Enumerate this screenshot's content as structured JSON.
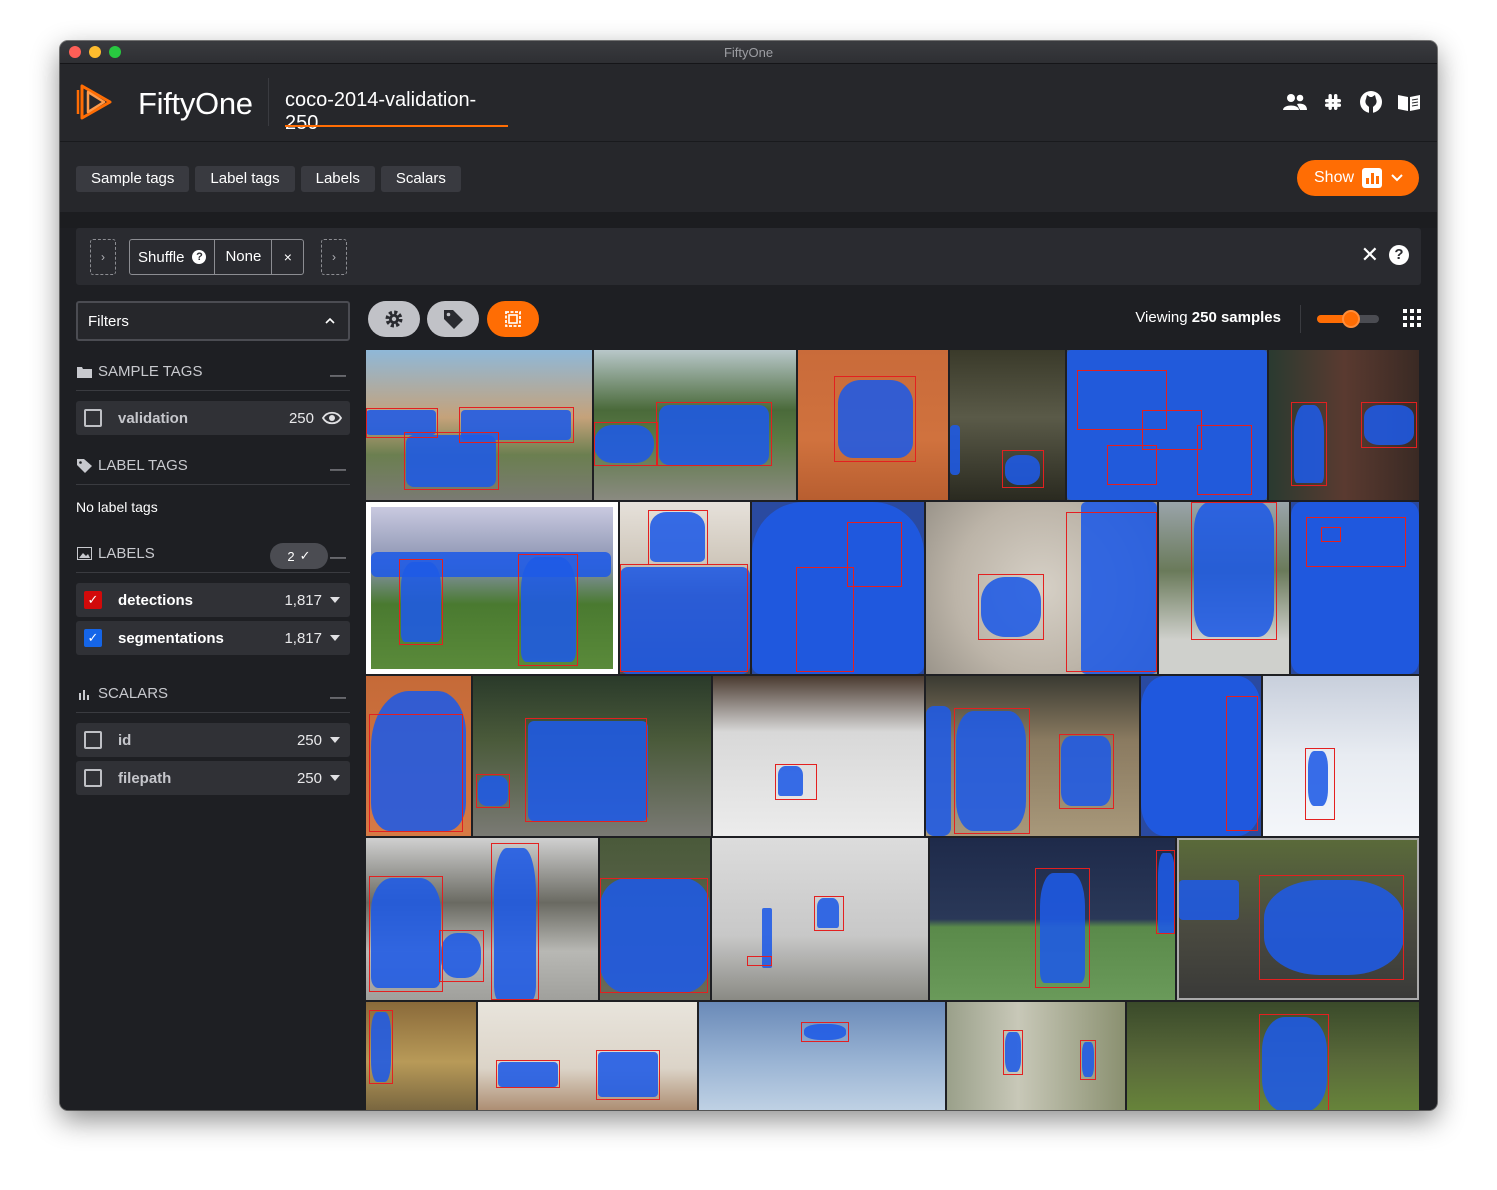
{
  "window": {
    "title": "FiftyOne"
  },
  "header": {
    "app_name": "FiftyOne",
    "dataset_name": "coco-2014-validation-250",
    "icons": [
      "people-icon",
      "slack-icon",
      "github-icon",
      "docs-book-icon"
    ]
  },
  "tabbar": {
    "tabs": [
      {
        "label": "Sample tags"
      },
      {
        "label": "Label tags"
      },
      {
        "label": "Labels"
      },
      {
        "label": "Scalars"
      }
    ],
    "show_button": {
      "label": "Show",
      "icon": "bar-chart-icon"
    }
  },
  "view_bar": {
    "stage_name": "Shuffle",
    "stage_param": "None",
    "stage_close": "×",
    "clear_label": "✕",
    "help_label": "?"
  },
  "sidebar": {
    "filters_label": "Filters",
    "sample_tags": {
      "title": "SAMPLE TAGS",
      "items": [
        {
          "label": "validation",
          "count": "250"
        }
      ]
    },
    "label_tags": {
      "title": "LABEL TAGS",
      "empty": "No label tags"
    },
    "labels": {
      "title": "LABELS",
      "badge": "2",
      "items": [
        {
          "label": "detections",
          "count": "1,817",
          "color": "#d20a0a",
          "checked": true
        },
        {
          "label": "segmentations",
          "count": "1,817",
          "color": "#1565e8",
          "checked": true
        }
      ]
    },
    "scalars": {
      "title": "SCALARS",
      "items": [
        {
          "label": "id",
          "count": "250"
        },
        {
          "label": "filepath",
          "count": "250"
        }
      ]
    }
  },
  "grid": {
    "viewing_prefix": "Viewing",
    "viewing_count": "250 samples",
    "zoom_level": 0.55,
    "toolbar_icons": [
      "gear-icon",
      "tag-icon",
      "patches-icon"
    ]
  },
  "colors": {
    "accent": "#ff6d04",
    "background": "#1e1f23",
    "panel": "#26272b",
    "detection_box": "#e32020",
    "segmentation_mask": "#1e5ae6"
  }
}
